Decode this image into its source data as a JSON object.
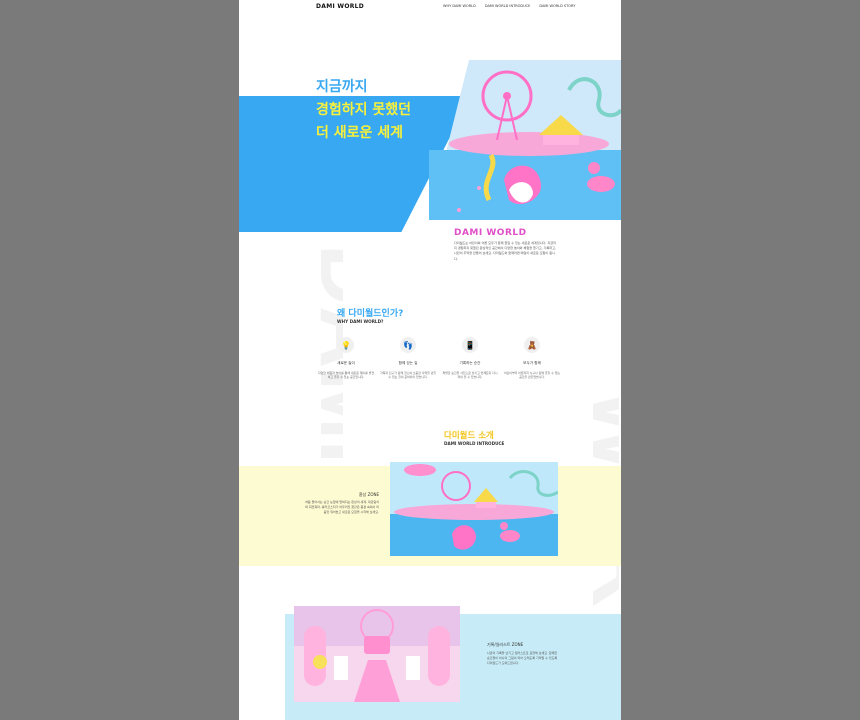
{
  "header": {
    "logo": "DAMI WORLD",
    "nav": [
      "WHY DAMI WORLD",
      "DAMI WORLD INTRODUCE",
      "DAMI WORLD STORY"
    ]
  },
  "hero": {
    "lines": [
      "지금까지",
      "경험하지 못했던",
      "더 새로운 세계"
    ]
  },
  "about": {
    "title": "DAMI WORLD",
    "desc": "다미월드는 어린이와 어른 모두가 함께 즐길 수 있는 새로운 세계입니다. 지금까지 경험하지 못했던 환상적인 공간에서 다양한 놀이와 체험을 즐기고, 기록하고, 나만의 추억을 만들어 보세요. 다미월드와 함께라면 매일이 새로운 모험이 됩니다."
  },
  "watermark": {
    "text": "DAMI",
    "text2": "WORLD"
  },
  "why": {
    "title": "왜 다미월드인가?",
    "subtitle": "WHY DAMI WORLD?",
    "features": [
      {
        "icon": "💡",
        "title": "새로운 놀이",
        "desc": "다양한 체험과 놀이를 통해 새로운 재미를 발견하고 즐길 수 있는 공간입니다."
      },
      {
        "icon": "👣",
        "title": "함께 걷는 길",
        "desc": "가족과 친구가 함께 걸으며 소중한 추억을 만들 수 있는 길이 준비되어 있습니다."
      },
      {
        "icon": "📱",
        "title": "기록하는 순간",
        "desc": "특별한 순간을 사진으로 남기고 언제든지 다시 꺼내 볼 수 있습니다."
      },
      {
        "icon": "🧸",
        "title": "모두가 함께",
        "desc": "어린이부터 어른까지 누구나 함께 즐길 수 있는 공간을 만들었습니다."
      }
    ]
  },
  "intro": {
    "title": "다미월드 소개",
    "subtitle": "DAMI WORLD INTRODUCE"
  },
  "zone1": {
    "title": "환상 ZONE",
    "desc": "처음 들어서는 순간 눈앞에 펼쳐지는 환상의 세계. 대관람차와 회전목마, 롤러코스터가 어우러진 꿈같은 풍경 속에서 마음껏 뛰어놀고 새로운 모험을 시작해 보세요."
  },
  "zone2": {
    "title": "기록/일러스트 ZONE",
    "desc": "나만의 기록을 남기고 일러스트로 표현해 보세요. 함께한 순간들이 하나의 그림이 되어 오래도록 기억될 수 있도록 다미월드가 도와드립니다."
  }
}
